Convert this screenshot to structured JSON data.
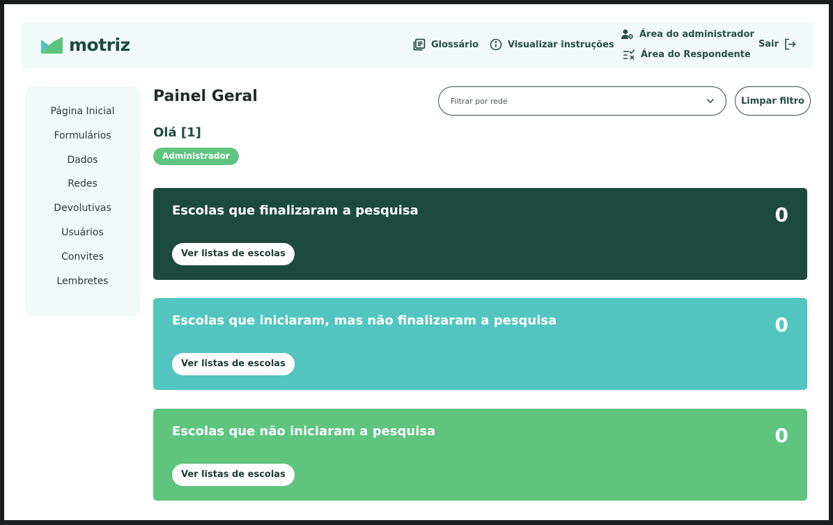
{
  "header": {
    "logo_text": "motriz",
    "nav": {
      "glossary": "Glossário",
      "instructions": "Visualizar instruções",
      "admin_area": "Área do administrador",
      "respondent_area": "Área do Respondente",
      "logout": "Sair"
    }
  },
  "sidebar": {
    "items": [
      {
        "label": "Página Inicial"
      },
      {
        "label": "Formulários"
      },
      {
        "label": "Dados"
      },
      {
        "label": "Redes"
      },
      {
        "label": "Devolutivas"
      },
      {
        "label": "Usuários"
      },
      {
        "label": "Convites"
      },
      {
        "label": "Lembretes"
      }
    ]
  },
  "main": {
    "title": "Painel Geral",
    "filter": {
      "placeholder": "Filtrar por rede",
      "clear_label": "Limpar filtro"
    },
    "greeting": "Olá [1]",
    "role": "Administrador",
    "cards": [
      {
        "title": "Escolas que finalizaram a pesquisa",
        "count": "0",
        "button": "Ver listas de escolas",
        "color": "#1d4a3f"
      },
      {
        "title": "Escolas que iniciaram, mas não finalizaram a pesquisa",
        "count": "0",
        "button": "Ver listas de escolas",
        "color": "#52c5c0"
      },
      {
        "title": "Escolas que não iniciaram a pesquisa",
        "count": "0",
        "button": "Ver listas de escolas",
        "color": "#5ec47e"
      }
    ]
  },
  "colors": {
    "brand_dark": "#1d4a3f",
    "brand_teal": "#52c5c0",
    "brand_green": "#5ec47e",
    "panel_bg": "#f1f9f9"
  },
  "icons": {
    "logo": "motriz-logo-icon",
    "glossary": "book-icon",
    "instructions": "info-icon",
    "admin": "user-gear-icon",
    "respondent": "checklist-icon",
    "logout": "logout-icon",
    "select": "chevron-down-icon"
  }
}
